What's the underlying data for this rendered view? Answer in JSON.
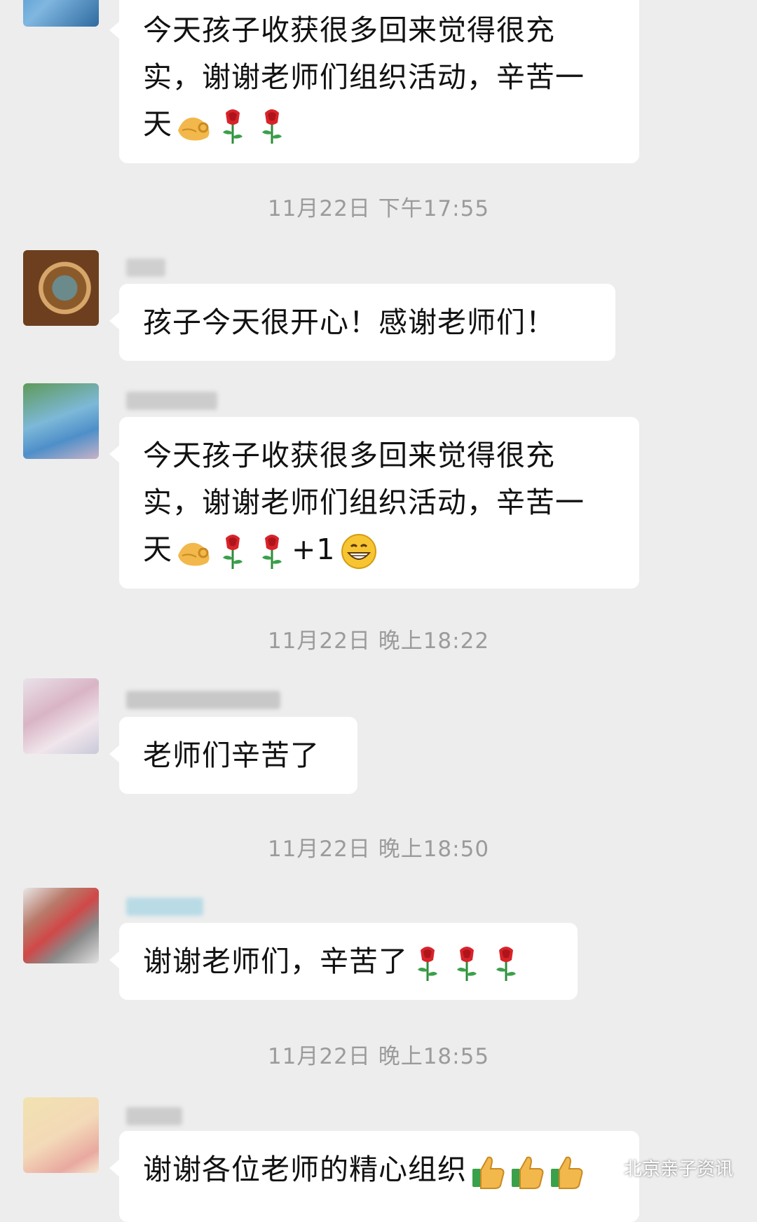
{
  "messages": [
    {
      "text_lines": [
        "今天孩子收获很多回来觉得很充",
        "实，谢谢老师们组织活动，辛苦一",
        "天"
      ],
      "emojis": [
        "ok-hand-icon",
        "rose-icon",
        "rose-icon"
      ]
    },
    {
      "time": "11月22日 下午17:55",
      "text": "孩子今天很开心！感谢老师们！"
    },
    {
      "text_lines": [
        "今天孩子收获很多回来觉得很充",
        "实，谢谢老师们组织活动，辛苦一",
        "天"
      ],
      "emojis": [
        "ok-hand-icon",
        "rose-icon",
        "rose-icon"
      ],
      "suffix": "+1",
      "suffix_emoji": "grin-icon"
    },
    {
      "time": "11月22日 晚上18:22",
      "text": "老师们辛苦了"
    },
    {
      "time": "11月22日 晚上18:50",
      "text": "谢谢老师们，辛苦了",
      "emojis": [
        "rose-icon",
        "rose-icon",
        "rose-icon"
      ]
    },
    {
      "time": "11月22日 晚上18:55",
      "text": "谢谢各位老师的精心组织",
      "emojis": [
        "thumbs-up-icon",
        "thumbs-up-icon",
        "thumbs-up-icon"
      ]
    }
  ],
  "watermark": "北京亲子资讯",
  "colors": {
    "background": "#ededed",
    "bubble": "#ffffff",
    "timestamp": "#9b9b9b"
  }
}
